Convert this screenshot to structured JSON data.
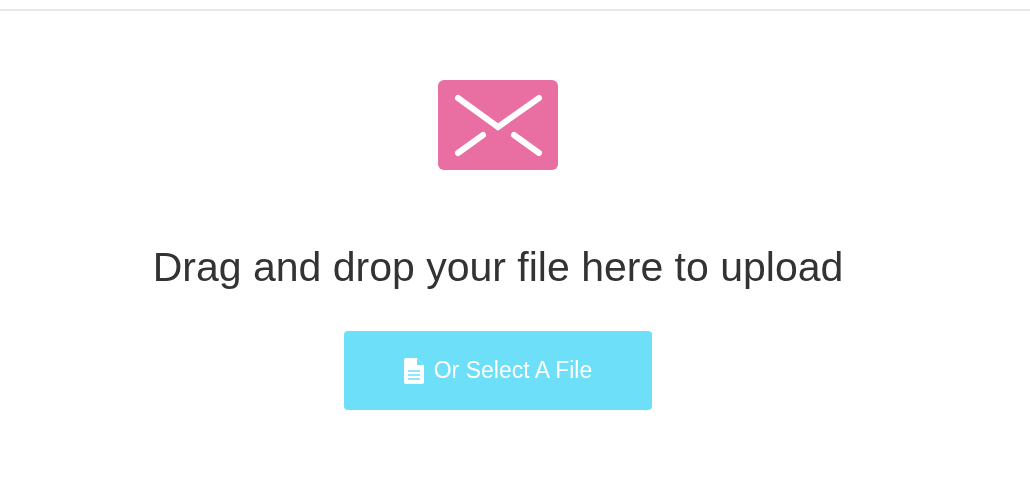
{
  "upload_area": {
    "message": "Drag and drop your file here to upload",
    "button": {
      "label": "Or Select A File"
    }
  }
}
